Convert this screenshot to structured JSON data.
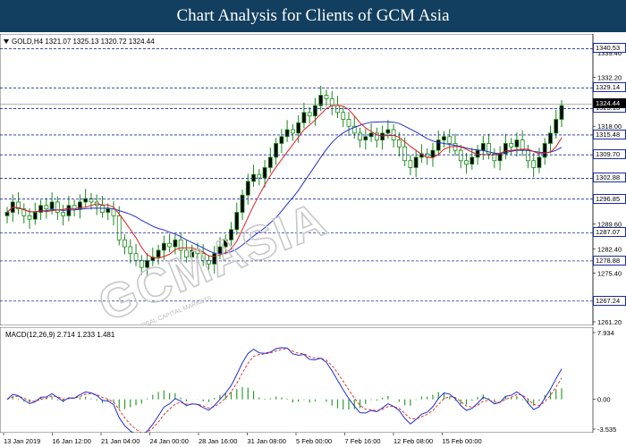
{
  "banner": {
    "title": "Chart Analysis for Clients of GCM Asia"
  },
  "symbol_info": "GOLD,H4  1321.07 1325.13 1320.72 1324.44",
  "macd_info": "MACD(12,26,9) 2.714 1.233 1.481",
  "watermark": {
    "brand": "GCMASIA",
    "sub": "GLOBAL CAPITAL MARKETS"
  },
  "colors": {
    "banner": "#123f5f",
    "level_line": "#1c2b9a",
    "ma_fast": "#e02020",
    "ma_slow": "#2030d0",
    "macd_hist": "#2e9e2e",
    "signal": "#e02020",
    "macd_line": "#2030d0",
    "candle": "#1a8a1a"
  },
  "chart_data": [
    {
      "type": "candlestick",
      "symbol": "GOLD",
      "timeframe": "H4",
      "ylim": [
        1261.2,
        1342.2
      ],
      "right_axis_ticks": [
        1339.4,
        1332.2,
        1325.5,
        1318.0,
        1310.8,
        1303.6,
        1296.6,
        1289.6,
        1282.4,
        1275.4,
        1268.4,
        1261.2
      ],
      "visible_tick_labels": [
        "1339.40",
        "1332.20",
        "1318.00",
        "1289.60",
        "1282.40",
        "1275.40",
        "1261.20"
      ],
      "price_levels": [
        1340.53,
        1329.14,
        1323.13,
        1315.48,
        1309.7,
        1302.88,
        1296.85,
        1287.07,
        1278.88,
        1267.24
      ],
      "current_price": 1324.44,
      "ohlc_closes": [
        1293,
        1296,
        1294,
        1292,
        1291,
        1293,
        1295,
        1294,
        1296,
        1293,
        1292,
        1295,
        1294,
        1296,
        1297,
        1296,
        1295,
        1293,
        1294,
        1292,
        1285,
        1283,
        1281,
        1279,
        1277,
        1279,
        1280,
        1282,
        1284,
        1283,
        1285,
        1282,
        1280,
        1282,
        1281,
        1279,
        1278,
        1281,
        1283,
        1285,
        1288,
        1293,
        1298,
        1302,
        1304,
        1303,
        1306,
        1309,
        1313,
        1315,
        1317,
        1316,
        1319,
        1322,
        1321,
        1324,
        1327,
        1326,
        1324,
        1322,
        1320,
        1318,
        1316,
        1314,
        1315,
        1316,
        1314,
        1316,
        1317,
        1314,
        1312,
        1308,
        1306,
        1309,
        1310,
        1309,
        1311,
        1314,
        1315,
        1313,
        1311,
        1308,
        1307,
        1309,
        1311,
        1313,
        1310,
        1308,
        1310,
        1313,
        1312,
        1314,
        1311,
        1308,
        1306,
        1309,
        1313,
        1316,
        1320,
        1324
      ],
      "x_axis_labels": [
        "13 Jan 2019",
        "16 Jan 12:00",
        "21 Jan 04:00",
        "24 Jan 00:00",
        "28 Jan 16:00",
        "31 Jan 08:00",
        "5 Feb 00:00",
        "7 Feb 16:00",
        "12 Feb 08:00",
        "15 Feb 00:00"
      ],
      "overlays": [
        "moving average (red)",
        "moving average (blue)"
      ]
    },
    {
      "type": "line",
      "name": "MACD(12,26,9)",
      "ylim": [
        -3.535,
        7.934
      ],
      "tick_labels": [
        "7.934",
        "0.00",
        "-3.535"
      ],
      "values_note": "histogram bars (green), signal line (red dashed), MACD line (blue)"
    }
  ]
}
